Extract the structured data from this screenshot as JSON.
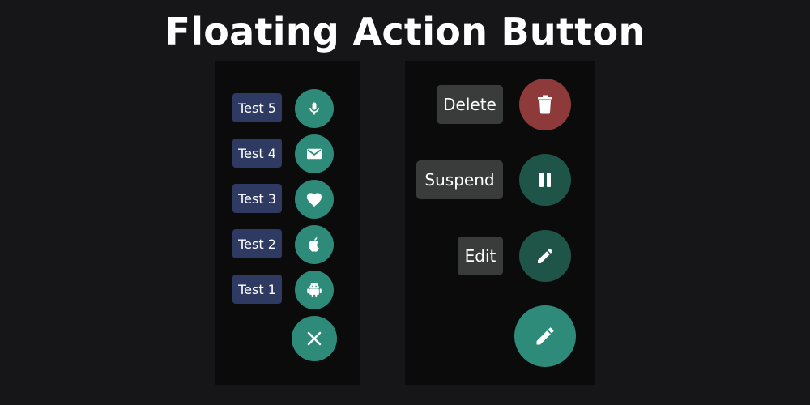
{
  "title": "Floating Action Button",
  "colors": {
    "background": "#161618",
    "panel": "#0b0b0c",
    "teal_fab": "#2e8b79",
    "dark_teal_fab": "#1f5548",
    "delete_fab": "#8e3a3b",
    "left_label_bg": "#2f3a63",
    "right_label_bg": "#3a3c3c"
  },
  "left_menu": {
    "items": [
      {
        "label": "Test 5",
        "icon": "mic-icon"
      },
      {
        "label": "Test 4",
        "icon": "mail-icon"
      },
      {
        "label": "Test 3",
        "icon": "heart-icon"
      },
      {
        "label": "Test 2",
        "icon": "apple-icon"
      },
      {
        "label": "Test 1",
        "icon": "android-icon"
      }
    ],
    "main_icon": "close-icon"
  },
  "right_menu": {
    "items": [
      {
        "label": "Delete",
        "icon": "trash-icon"
      },
      {
        "label": "Suspend",
        "icon": "pause-icon"
      },
      {
        "label": "Edit",
        "icon": "pencil-icon"
      }
    ],
    "main_icon": "pencil-icon"
  }
}
